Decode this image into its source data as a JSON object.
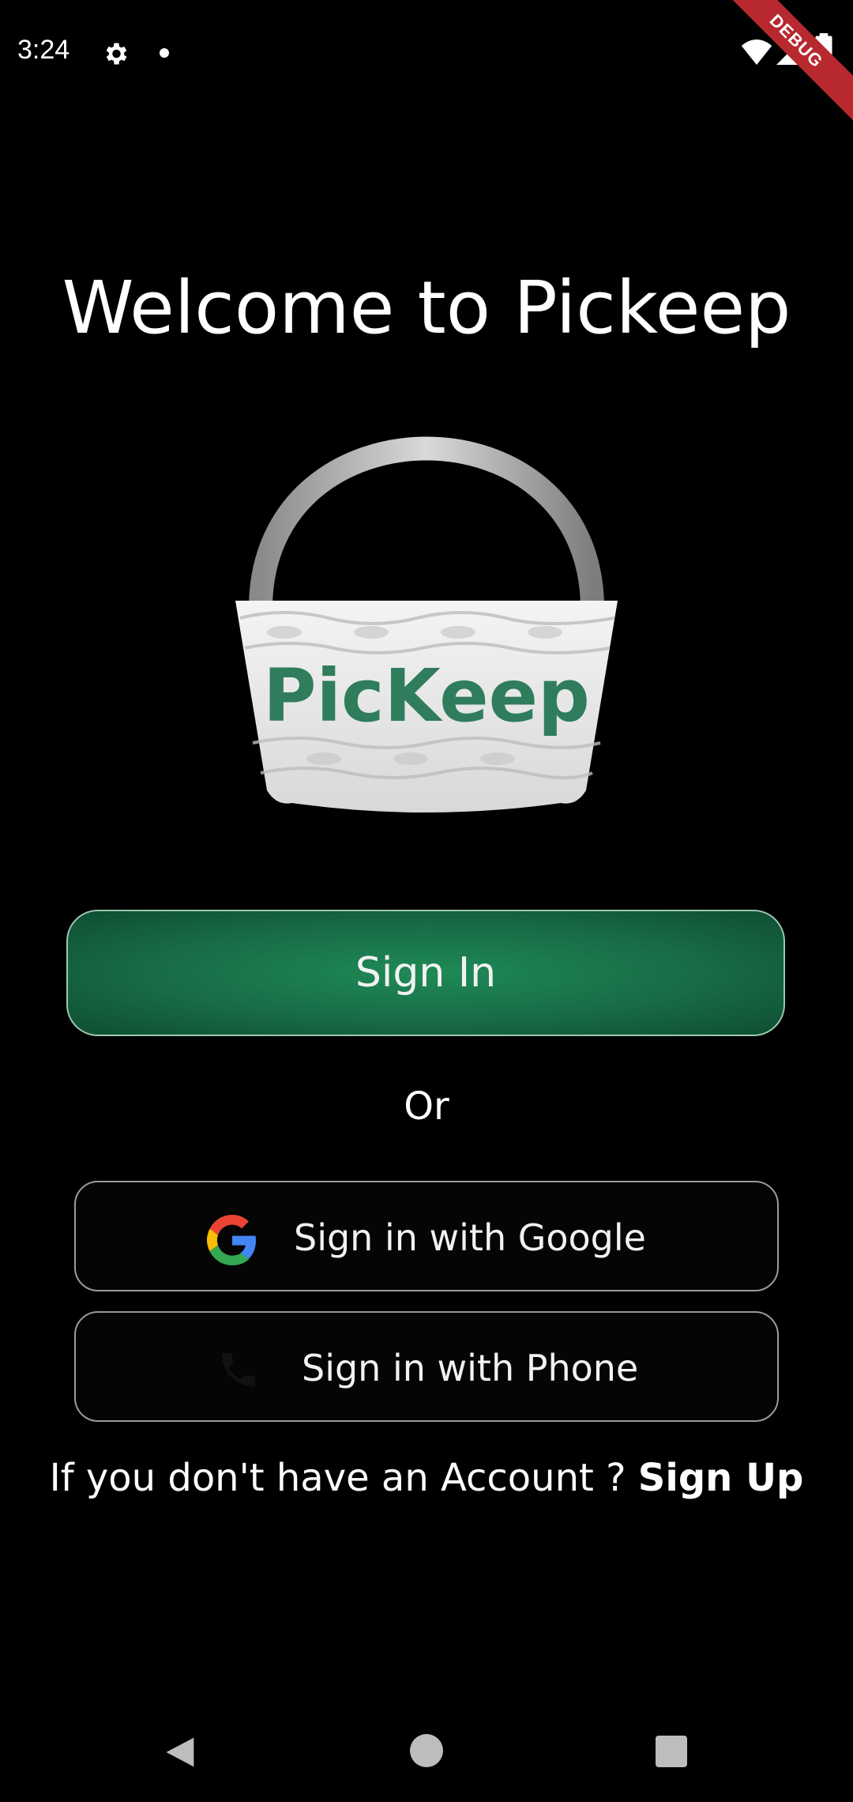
{
  "status_bar": {
    "time": "3:24",
    "icons": [
      "gear-icon",
      "dot-icon",
      "wifi-icon",
      "signal-icon",
      "battery-icon"
    ],
    "debug_label": "DEBUG"
  },
  "header": {
    "title": "Welcome to Pickeep"
  },
  "logo": {
    "text": "PicKeep"
  },
  "buttons": {
    "sign_in": "Sign In",
    "or": "Or",
    "google": "Sign in with Google",
    "phone": "Sign in with Phone"
  },
  "footer": {
    "prompt": "If you don't have an Account ? ",
    "signup": "Sign Up"
  },
  "nav": {
    "icons": [
      "back-icon",
      "home-icon",
      "recents-icon"
    ]
  },
  "colors": {
    "background": "#000000",
    "primary_green": "#1f8a57",
    "logo_green": "#2f7d5c",
    "text": "#ffffff"
  }
}
